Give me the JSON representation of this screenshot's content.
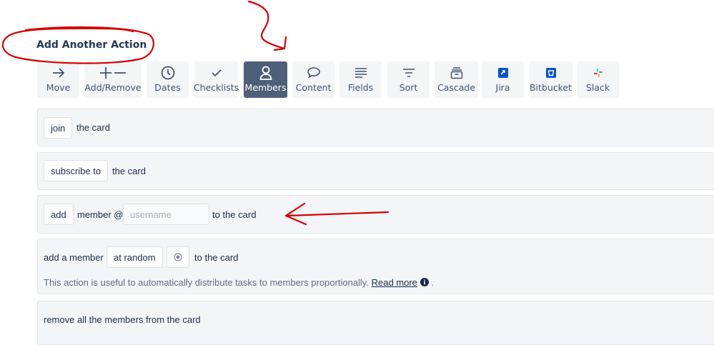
{
  "heading": "Add Another Action",
  "toolbar": {
    "buttons": [
      {
        "label": "Move",
        "icon": "arrow-right-icon"
      },
      {
        "label": "Add/Remove",
        "icon": "plus-minus-icon"
      },
      {
        "label": "Dates",
        "icon": "clock-icon"
      },
      {
        "label": "Checklists",
        "icon": "checkmark-icon"
      },
      {
        "label": "Members",
        "icon": "person-icon",
        "active": true
      },
      {
        "label": "Content",
        "icon": "speech-bubble-icon"
      },
      {
        "label": "Fields",
        "icon": "fields-lines-icon"
      },
      {
        "label": "Sort",
        "icon": "sort-filter-icon"
      },
      {
        "label": "Cascade",
        "icon": "cascade-box-icon"
      },
      {
        "label": "Jira",
        "icon": "jira-logo-icon"
      },
      {
        "label": "Bitbucket",
        "icon": "bitbucket-logo-icon"
      },
      {
        "label": "Slack",
        "icon": "slack-logo-icon"
      }
    ]
  },
  "actions": {
    "join": {
      "button": "join",
      "suffix": "the card"
    },
    "subscribe": {
      "button": "subscribe to",
      "suffix": "the card"
    },
    "add_member": {
      "button": "add",
      "middle": "member @",
      "placeholder": "username",
      "suffix": "to the card"
    },
    "random": {
      "prefix": "add a member",
      "button": "at random",
      "suffix": "to the card",
      "description": "This action is useful to automatically distribute tasks to members proportionally.",
      "read_more": "Read more",
      "period": "."
    },
    "remove_all": {
      "text": "remove all the members from the card"
    }
  },
  "colors": {
    "active_tool": "#505f79",
    "panel_bg": "#f4f5f7",
    "annotation": "#d40000"
  }
}
